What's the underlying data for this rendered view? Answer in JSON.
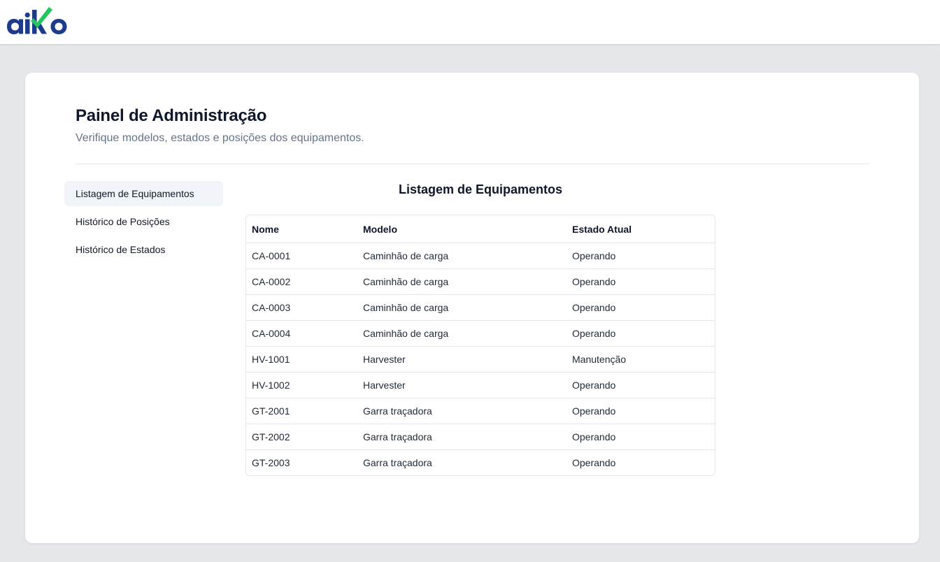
{
  "header": {
    "logo_text": "aiko",
    "logo_colors": {
      "primary": "#1e3a8a",
      "accent": "#22c55e"
    }
  },
  "page": {
    "title": "Painel de Administração",
    "subtitle": "Verifique modelos, estados e posições dos equipamentos."
  },
  "sidebar": {
    "items": [
      {
        "label": "Listagem de Equipamentos",
        "active": true
      },
      {
        "label": "Histórico de Posições",
        "active": false
      },
      {
        "label": "Histórico de Estados",
        "active": false
      }
    ]
  },
  "main": {
    "section_title": "Listagem de Equipamentos",
    "table": {
      "columns": [
        "Nome",
        "Modelo",
        "Estado Atual"
      ],
      "rows": [
        [
          "CA-0001",
          "Caminhão de carga",
          "Operando"
        ],
        [
          "CA-0002",
          "Caminhão de carga",
          "Operando"
        ],
        [
          "CA-0003",
          "Caminhão de carga",
          "Operando"
        ],
        [
          "CA-0004",
          "Caminhão de carga",
          "Operando"
        ],
        [
          "HV-1001",
          "Harvester",
          "Manutenção"
        ],
        [
          "HV-1002",
          "Harvester",
          "Operando"
        ],
        [
          "GT-2001",
          "Garra traçadora",
          "Operando"
        ],
        [
          "GT-2002",
          "Garra traçadora",
          "Operando"
        ],
        [
          "GT-2003",
          "Garra traçadora",
          "Operando"
        ]
      ]
    }
  }
}
